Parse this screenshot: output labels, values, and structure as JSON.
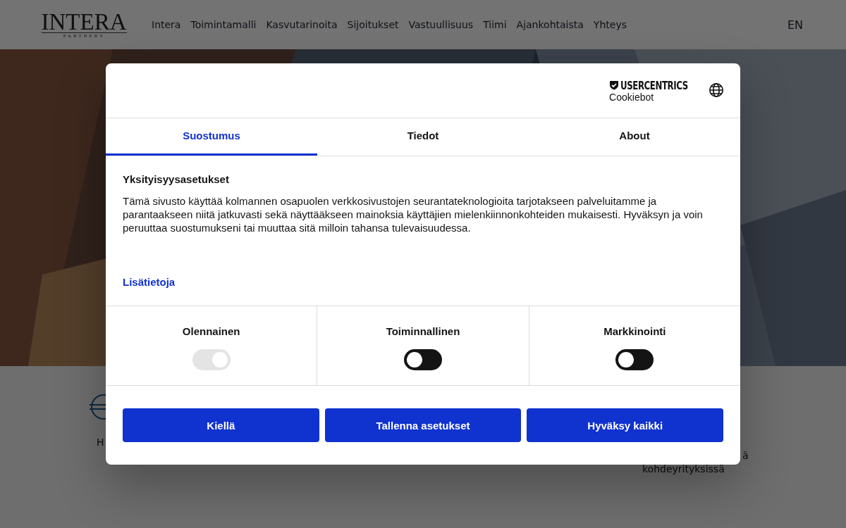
{
  "header": {
    "logo": {
      "name": "INTERA",
      "tagline": "PARTNERS"
    },
    "nav": [
      {
        "label": "Intera"
      },
      {
        "label": "Toimintamalli"
      },
      {
        "label": "Kasvutarinoita"
      },
      {
        "label": "Sijoitukset"
      },
      {
        "label": "Vastuullisuus"
      },
      {
        "label": "Tiimi"
      },
      {
        "label": "Ajankohtaista"
      },
      {
        "label": "Yhteys"
      }
    ],
    "language": "EN"
  },
  "features": [
    {
      "lines": [
        "H"
      ]
    },
    {
      "lines": [
        "ä",
        "kohdeyrityksissä"
      ]
    }
  ],
  "dialog": {
    "brand": {
      "name": "USERCENTRICS",
      "product": "Cookiebot"
    },
    "tabs": [
      {
        "label": "Suostumus",
        "selected": true
      },
      {
        "label": "Tiedot",
        "selected": false
      },
      {
        "label": "About",
        "selected": false
      }
    ],
    "heading": "Yksityisyysasetukset",
    "body": "Tämä sivusto käyttää kolmannen osapuolen verkkosivustojen seurantateknologioita tarjotakseen palveluitamme ja parantaakseen niitä jatkuvasti sekä näyttääkseen mainoksia käyttäjien mielenkiinnonkohteiden mukaisesti. Hyväksyn ja voin peruuttaa suostumukseni tai muuttaa sitä milloin tahansa tulevaisuudessa.",
    "link": "Lisätietoja",
    "categories": [
      {
        "label": "Olennainen",
        "on": true,
        "disabled": true
      },
      {
        "label": "Toiminnallinen",
        "on": false,
        "disabled": false
      },
      {
        "label": "Markkinointi",
        "on": false,
        "disabled": false
      }
    ],
    "buttons": [
      "Kiellä",
      "Tallenna asetukset",
      "Hyväksy kaikki"
    ]
  }
}
